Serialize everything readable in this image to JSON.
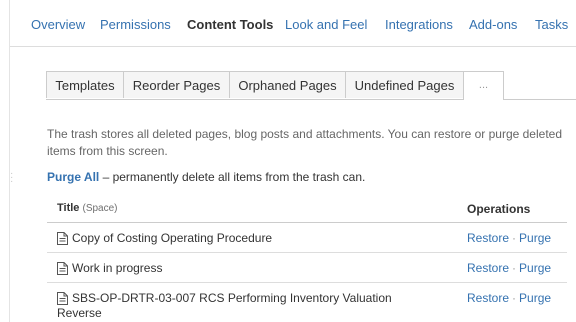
{
  "nav": {
    "tabs": [
      {
        "label": "Overview",
        "active": false
      },
      {
        "label": "Permissions",
        "active": false
      },
      {
        "label": "Content Tools",
        "active": true
      },
      {
        "label": "Look and Feel",
        "active": false
      },
      {
        "label": "Integrations",
        "active": false
      },
      {
        "label": "Add-ons",
        "active": false
      },
      {
        "label": "Tasks",
        "active": false
      }
    ]
  },
  "subtabs": [
    {
      "label": "Templates"
    },
    {
      "label": "Reorder Pages"
    },
    {
      "label": "Orphaned Pages"
    },
    {
      "label": "Undefined Pages"
    },
    {
      "label": "..."
    }
  ],
  "trash": {
    "description": "The trash stores all deleted pages, blog posts and attachments. You can restore or purge deleted items from this screen.",
    "purge_all_label": "Purge All",
    "purge_all_desc": " – permanently delete all items from the trash can."
  },
  "table": {
    "col_title": "Title",
    "col_space": "(Space)",
    "col_ops": "Operations",
    "restore_label": "Restore",
    "sep": "·",
    "purge_label": "Purge",
    "rows": [
      {
        "title": "Copy of Costing Operating Procedure",
        "icon": "page-icon"
      },
      {
        "title": "Work in progress",
        "icon": "page-icon"
      },
      {
        "title": "SBS-OP-DRTR-03-007 RCS Performing Inventory Valuation Reverse",
        "icon": "page-icon"
      }
    ]
  },
  "colors": {
    "link": "#3572b0",
    "text": "#333333",
    "muted": "#666666",
    "border": "#cccccc"
  }
}
